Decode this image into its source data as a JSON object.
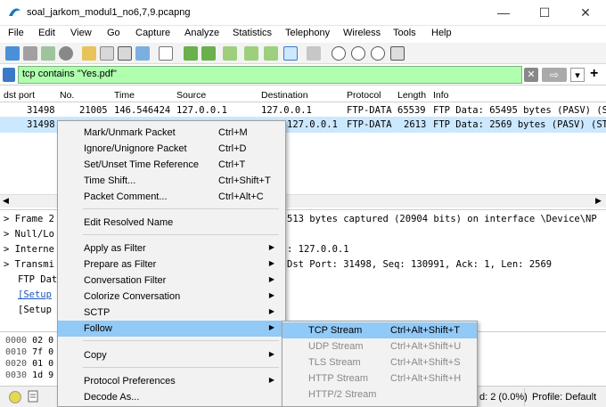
{
  "window": {
    "title": "soal_jarkom_modul1_no6,7,9.pcapng",
    "minimize": "—",
    "maximize": "☐",
    "close": "✕"
  },
  "menubar": [
    "File",
    "Edit",
    "View",
    "Go",
    "Capture",
    "Analyze",
    "Statistics",
    "Telephony",
    "Wireless",
    "Tools",
    "Help"
  ],
  "filter": {
    "value": "tcp contains \"Yes.pdf\"",
    "clear": "✕",
    "apply": "⇨",
    "dropdown": "▾",
    "add": "+"
  },
  "columns": [
    "dst port",
    "No.",
    "Time",
    "Source",
    "Destination",
    "Protocol",
    "Length",
    "Info"
  ],
  "packets": [
    {
      "dstport": "31498",
      "no": "21005",
      "time": "146.546424",
      "src": "127.0.0.1",
      "dst": "127.0.0.1",
      "proto": "FTP-DATA",
      "len": "65539",
      "info": "FTP Data: 65495 bytes (PASV) (S"
    },
    {
      "dstport": "31498",
      "no": "",
      "time": "",
      "src": "",
      "dst": "127.0.0.1",
      "proto": "FTP-DATA",
      "len": "2613",
      "info": "FTP Data: 2569 bytes (PASV) (ST"
    }
  ],
  "details": [
    {
      "prefix": ">",
      "left": "Frame 2",
      "right": "513 bytes captured (20904 bits) on interface \\Device\\NP"
    },
    {
      "prefix": ">",
      "left": "Null/Lo",
      "right": ""
    },
    {
      "prefix": ">",
      "left": "Interne",
      "right": ": 127.0.0.1"
    },
    {
      "prefix": ">",
      "left": "Transmi",
      "right": "Dst Port: 31498, Seq: 130991, Ack: 1, Len: 2569"
    },
    {
      "prefix": "",
      "left": "FTP Dat",
      "right": ""
    },
    {
      "prefix": "",
      "left": "[Setup",
      "right": ""
    },
    {
      "prefix": "",
      "left": "[Setup",
      "right": ""
    }
  ],
  "bytes": [
    {
      "off": "0000",
      "hex": "02 0"
    },
    {
      "off": "0010",
      "hex": "7f 0"
    },
    {
      "off": "0020",
      "hex": "01 0"
    },
    {
      "off": "0030",
      "hex": "1d 9"
    }
  ],
  "statusbar": {
    "displayed": "d: 2 (0.0%)",
    "profile": "Profile: Default"
  },
  "context_menu": [
    {
      "label": "Mark/Unmark Packet",
      "shortcut": "Ctrl+M"
    },
    {
      "label": "Ignore/Unignore Packet",
      "shortcut": "Ctrl+D"
    },
    {
      "label": "Set/Unset Time Reference",
      "shortcut": "Ctrl+T"
    },
    {
      "label": "Time Shift...",
      "shortcut": "Ctrl+Shift+T"
    },
    {
      "label": "Packet Comment...",
      "shortcut": "Ctrl+Alt+C"
    },
    {
      "label": "Edit Resolved Name",
      "shortcut": ""
    },
    {
      "label": "Apply as Filter",
      "shortcut": ""
    },
    {
      "label": "Prepare as Filter",
      "shortcut": ""
    },
    {
      "label": "Conversation Filter",
      "shortcut": ""
    },
    {
      "label": "Colorize Conversation",
      "shortcut": ""
    },
    {
      "label": "SCTP",
      "shortcut": ""
    },
    {
      "label": "Follow",
      "shortcut": ""
    },
    {
      "label": "Copy",
      "shortcut": ""
    },
    {
      "label": "Protocol Preferences",
      "shortcut": ""
    },
    {
      "label": "Decode As...",
      "shortcut": ""
    }
  ],
  "follow_submenu": [
    {
      "label": "TCP Stream",
      "shortcut": "Ctrl+Alt+Shift+T"
    },
    {
      "label": "UDP Stream",
      "shortcut": "Ctrl+Alt+Shift+U"
    },
    {
      "label": "TLS Stream",
      "shortcut": "Ctrl+Alt+Shift+S"
    },
    {
      "label": "HTTP Stream",
      "shortcut": "Ctrl+Alt+Shift+H"
    },
    {
      "label": "HTTP/2 Stream",
      "shortcut": ""
    }
  ],
  "colors": {
    "filter_ok": "#afffaf",
    "selected_row": "#cce8ff",
    "menu_highlight": "#91c9f7",
    "accent": "#3b79c7"
  }
}
